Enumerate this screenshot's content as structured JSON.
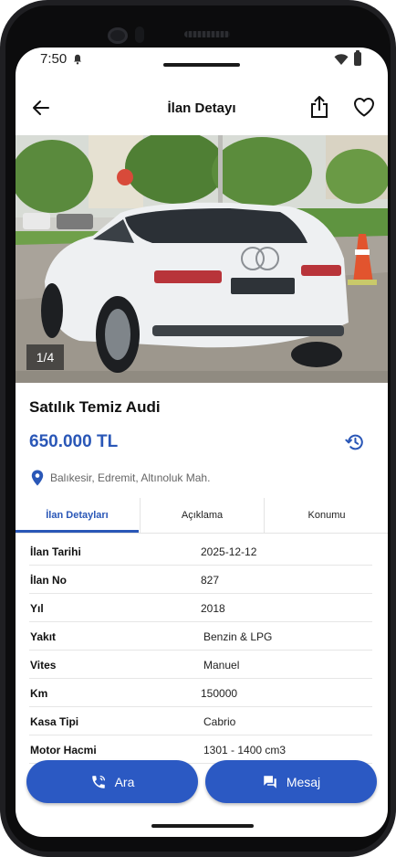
{
  "status_bar": {
    "time": "7:50"
  },
  "app_bar": {
    "title": "İlan Detayı"
  },
  "gallery": {
    "counter": "1/4"
  },
  "listing": {
    "title": "Satılık Temiz Audi",
    "price": "650.000 TL",
    "location": "Balıkesir, Edremit, Altınoluk Mah."
  },
  "tabs": [
    "İlan Detayları",
    "Açıklama",
    "Konumu"
  ],
  "details": [
    {
      "key": "İlan Tarihi",
      "value": "2025-12-12"
    },
    {
      "key": "İlan No",
      "value": "827"
    },
    {
      "key": "Yıl",
      "value": "2018"
    },
    {
      "key": "Yakıt",
      "value": "Benzin & LPG"
    },
    {
      "key": "Vites",
      "value": "Manuel"
    },
    {
      "key": "Km",
      "value": "150000"
    },
    {
      "key": "Kasa Tipi",
      "value": "Cabrio"
    },
    {
      "key": "Motor Hacmi",
      "value": "1301 - 1400 cm3"
    }
  ],
  "actions": {
    "call": "Ara",
    "message": "Mesaj"
  },
  "colors": {
    "accent": "#2a57b7",
    "button": "#2b59c3"
  }
}
